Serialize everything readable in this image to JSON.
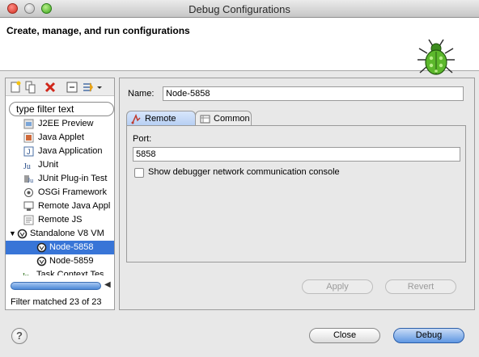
{
  "window": {
    "title": "Debug Configurations"
  },
  "header": {
    "title": "Create, manage, and run configurations"
  },
  "left_panel": {
    "filter_placeholder": "type filter text",
    "tree": [
      {
        "label": "J2EE Preview",
        "icon": "j2ee-preview-icon",
        "indent": 1,
        "selected": false
      },
      {
        "label": "Java Applet",
        "icon": "java-applet-icon",
        "indent": 1,
        "selected": false
      },
      {
        "label": "Java Application",
        "icon": "java-application-icon",
        "indent": 1,
        "selected": false
      },
      {
        "label": "JUnit",
        "icon": "junit-icon",
        "indent": 1,
        "selected": false
      },
      {
        "label": "JUnit Plug-in Test",
        "icon": "junit-plugin-icon",
        "indent": 1,
        "selected": false
      },
      {
        "label": "OSGi Framework",
        "icon": "osgi-icon",
        "indent": 1,
        "selected": false
      },
      {
        "label": "Remote Java Appl",
        "icon": "remote-java-icon",
        "indent": 1,
        "selected": false
      },
      {
        "label": "Remote JS",
        "icon": "remote-js-icon",
        "indent": 1,
        "selected": false
      },
      {
        "label": "Standalone V8 VM",
        "icon": "v8-vm-icon",
        "indent": 0,
        "selected": false
      },
      {
        "label": "Node-5858",
        "icon": "v8-config-icon",
        "indent": 2,
        "selected": true
      },
      {
        "label": "Node-5859",
        "icon": "v8-config-icon",
        "indent": 2,
        "selected": false
      },
      {
        "label": "Task Context Tes",
        "icon": "task-context-icon",
        "indent": 1,
        "selected": false
      }
    ],
    "status": "Filter matched 23 of 23"
  },
  "right_panel": {
    "name_label": "Name:",
    "name_value": "Node-5858",
    "tabs": [
      {
        "label": "Remote",
        "active": true
      },
      {
        "label": "Common",
        "active": false
      }
    ],
    "port_label": "Port:",
    "port_value": "5858",
    "checkbox_label": "Show debugger network communication console",
    "apply_label": "Apply",
    "revert_label": "Revert"
  },
  "footer": {
    "help_label": "?",
    "close_label": "Close",
    "debug_label": "Debug"
  }
}
